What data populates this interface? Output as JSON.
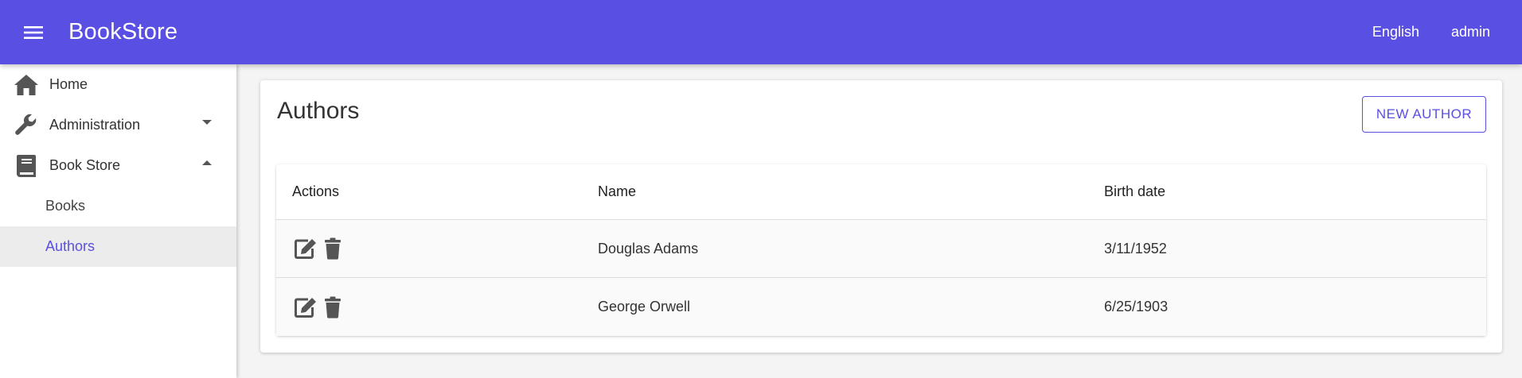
{
  "app": {
    "title": "BookStore"
  },
  "header": {
    "language": "English",
    "user": "admin"
  },
  "sidebar": {
    "items": [
      {
        "label": "Home",
        "icon": "home-icon"
      },
      {
        "label": "Administration",
        "icon": "wrench-icon",
        "expanded": false
      },
      {
        "label": "Book Store",
        "icon": "book-icon",
        "expanded": true
      }
    ],
    "subitems": [
      {
        "label": "Books",
        "active": false
      },
      {
        "label": "Authors",
        "active": true
      }
    ]
  },
  "main": {
    "title": "Authors",
    "new_button": "NEW AUTHOR",
    "table": {
      "columns": [
        "Actions",
        "Name",
        "Birth date"
      ],
      "rows": [
        {
          "name": "Douglas Adams",
          "birth_date": "3/11/1952"
        },
        {
          "name": "George Orwell",
          "birth_date": "6/25/1903"
        }
      ]
    }
  },
  "colors": {
    "primary": "#5a4fe3",
    "icon_gray": "#555555"
  }
}
